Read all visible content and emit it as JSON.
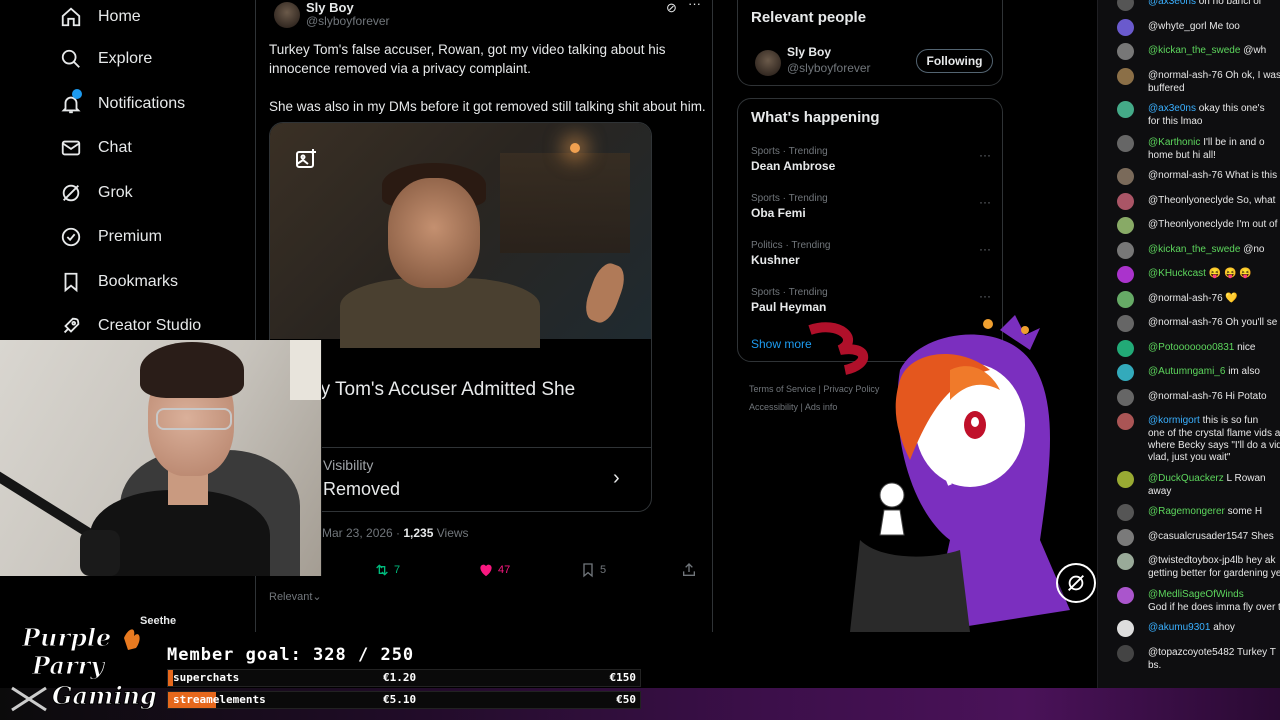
{
  "nav": {
    "items": [
      {
        "label": "Home",
        "icon": "home-icon"
      },
      {
        "label": "Explore",
        "icon": "search-icon"
      },
      {
        "label": "Notifications",
        "icon": "bell-icon"
      },
      {
        "label": "Chat",
        "icon": "mail-icon"
      },
      {
        "label": "Grok",
        "icon": "grok-icon"
      },
      {
        "label": "Premium",
        "icon": "verified-icon"
      },
      {
        "label": "Bookmarks",
        "icon": "bookmark-icon"
      },
      {
        "label": "Creator Studio",
        "icon": "rocket-icon"
      }
    ]
  },
  "tweet": {
    "author_name": "Sly Boy",
    "author_handle": "@slyboyforever",
    "text_line1": "Turkey Tom's false accuser, Rowan, got my video talking about his innocence removed via a privacy complaint.",
    "text_line2": "She was also in my DMs before it got removed still talking shit about him.",
    "card_title": "ey Tom's Accuser Admitted She",
    "card_sub1": "Visibility",
    "card_sub2": "Removed",
    "date": "Mar 23, 2026 · ",
    "views_count": "1,235",
    "views_label": " Views",
    "retweets": "7",
    "likes": "47",
    "bookmarks": "5",
    "sort_label": "Relevant"
  },
  "relevant_people": {
    "title": "Relevant people",
    "name": "Sly Boy",
    "handle": "@slyboyforever",
    "button": "Following"
  },
  "happening": {
    "title": "What's happening",
    "trends": [
      {
        "category": "Sports · Trending",
        "name": "Dean Ambrose"
      },
      {
        "category": "Sports · Trending",
        "name": "Oba Femi"
      },
      {
        "category": "Politics · Trending",
        "name": "Kushner"
      },
      {
        "category": "Sports · Trending",
        "name": "Paul Heyman"
      }
    ],
    "show_more": "Show more"
  },
  "footer": {
    "links1": "Terms of Service  |  Privacy Policy",
    "links2": "Accessibility  |  Ads info"
  },
  "chat": {
    "messages": [
      {
        "user": "@ax3e0ns",
        "text": "oh no bahci ol",
        "color": "#3ab0ff"
      },
      {
        "user": "@whyte_gorl",
        "text": "Me too",
        "color": "#e8e8e8"
      },
      {
        "user": "@kickan_the_swede",
        "text": "@wh",
        "color": "#5dd65d"
      },
      {
        "user": "@normal-ash-76",
        "text": "Oh ok, I was",
        "cont": "buffered",
        "color": "#e8e8e8"
      },
      {
        "user": "@ax3e0ns",
        "text": "okay this one's",
        "cont": "for this lmao",
        "color": "#3ab0ff"
      },
      {
        "user": "@Karthonic",
        "text": "I'll be in and o",
        "cont": "home but hi all!",
        "color": "#5dd65d"
      },
      {
        "user": "@normal-ash-76",
        "text": "What is this",
        "color": "#e8e8e8"
      },
      {
        "user": "@Theonlyoneclyde",
        "text": "So, what",
        "color": "#e8e8e8"
      },
      {
        "user": "@Theonlyoneclyde",
        "text": "I'm out of",
        "color": "#e8e8e8"
      },
      {
        "user": "@kickan_the_swede",
        "text": "@no",
        "color": "#5dd65d"
      },
      {
        "user": "@KHuckcast",
        "text": "😝 😝 😝",
        "color": "#5dd65d"
      },
      {
        "user": "@normal-ash-76",
        "text": "💛",
        "color": "#e8e8e8"
      },
      {
        "user": "@normal-ash-76",
        "text": "Oh you'll se",
        "color": "#e8e8e8"
      },
      {
        "user": "@Potooooooo0831",
        "text": "nice",
        "color": "#5dd65d"
      },
      {
        "user": "@Autumngami_6",
        "text": "im also",
        "color": "#5dd65d"
      },
      {
        "user": "@normal-ash-76",
        "text": "Hi Potato",
        "color": "#e8e8e8"
      },
      {
        "user": "@kormigort",
        "text": "this is so fun",
        "cont": "one of the crystal flame vids a",
        "cont2": "where Becky says \"I'll do a vid",
        "cont3": "vlad, just you wait\"",
        "color": "#3ab0ff"
      },
      {
        "user": "@DuckQuackerz",
        "text": "L Rowan",
        "cont": "away",
        "color": "#5dd65d"
      },
      {
        "user": "@Ragemongerer",
        "text": "some H",
        "color": "#5dd65d"
      },
      {
        "user": "@casualcrusader1547",
        "text": "Shes",
        "color": "#e8e8e8"
      },
      {
        "user": "@twistedtoybox-jp4lb",
        "text": "hey ak",
        "cont": "getting better for gardening ye",
        "color": "#e8e8e8"
      },
      {
        "user": "@MedliSageOfWinds",
        "text": "",
        "cont": "God if he does imma fly over t",
        "color": "#5dd65d"
      },
      {
        "user": "@akumu9301",
        "text": "ahoy",
        "color": "#3ab0ff"
      },
      {
        "user": "@topazcoyote5482",
        "text": "Turkey T",
        "cont": "bs.",
        "color": "#e8e8e8"
      }
    ]
  },
  "overlay": {
    "logo_text": [
      "Purple",
      "Parry",
      "Gaming"
    ],
    "goal_text": "Member goal: 328 / 250",
    "seethe_name": "Seethe",
    "bars": [
      {
        "label": "superchats",
        "current": "€1.20",
        "max": "€150",
        "progress": 0.008
      },
      {
        "label": "streamelements",
        "current": "€5.10",
        "max": "€50",
        "progress": 0.102
      }
    ]
  },
  "colors": {
    "accent_blue": "#1d9bf0",
    "like_pink": "#f91880",
    "retweet_green": "#00ba7c",
    "bar_orange": "#e6681c",
    "vtuber_purple": "#7b2fbf"
  }
}
